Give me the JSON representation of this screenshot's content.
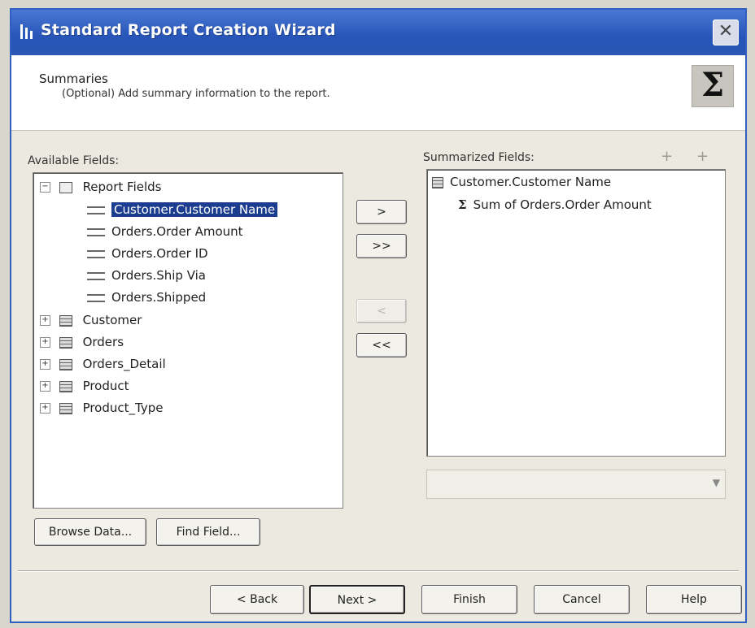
{
  "window": {
    "title": "Standard Report Creation Wizard",
    "close_glyph": "✕"
  },
  "header": {
    "title": "Summaries",
    "subtitle": "(Optional) Add summary information to the report.",
    "badge_glyph": "Σ"
  },
  "available": {
    "label": "Available Fields:",
    "root": {
      "label": "Report Fields",
      "expander": "−"
    },
    "fields": [
      "Customer.Customer Name",
      "Orders.Order Amount",
      "Orders.Order ID",
      "Orders.Ship Via",
      "Orders.Shipped"
    ],
    "tables": [
      {
        "label": "Customer",
        "expander": "+"
      },
      {
        "label": "Orders",
        "expander": "+"
      },
      {
        "label": "Orders_Detail",
        "expander": "+"
      },
      {
        "label": "Product",
        "expander": "+"
      },
      {
        "label": "Product_Type",
        "expander": "+"
      }
    ]
  },
  "transfer": {
    "add": ">",
    "add_all": ">>",
    "remove": "<",
    "remove_all": "<<"
  },
  "summarized": {
    "label": "Summarized Fields:",
    "group": "Customer.Customer Name",
    "summaries": [
      "Sum of Orders.Order Amount"
    ],
    "sigma": "Σ",
    "icons": [
      "+",
      "+"
    ]
  },
  "buttons": {
    "browse": "Browse Data...",
    "find": "Find Field...",
    "back": "< Back",
    "next": "Next >",
    "finish": "Finish",
    "cancel": "Cancel",
    "help": "Help"
  }
}
